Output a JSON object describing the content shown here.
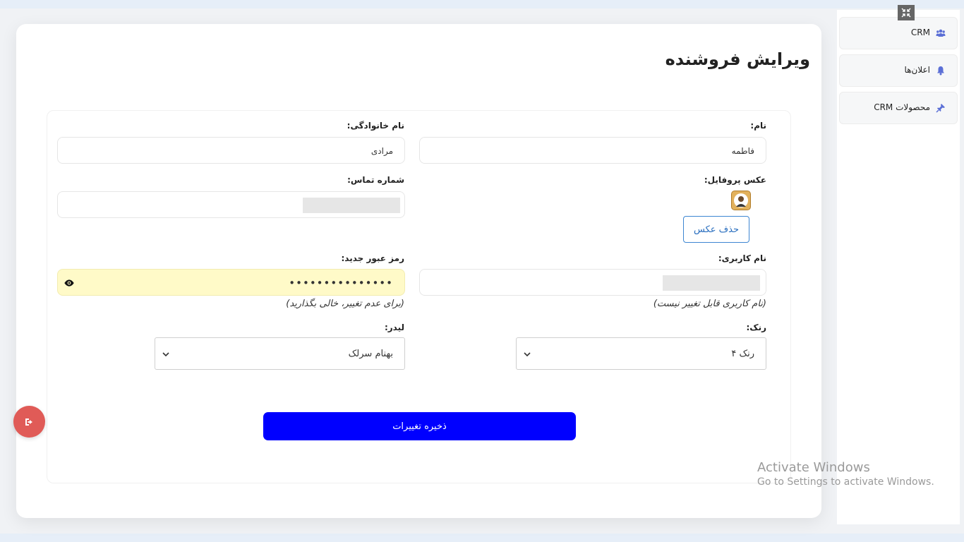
{
  "page": {
    "title": "ویرایش فروشنده"
  },
  "form": {
    "first_name": {
      "label": "نام:",
      "value": "فاطمه"
    },
    "last_name": {
      "label": "نام خانوادگی:",
      "value": "مرادی"
    },
    "profile_photo": {
      "label": "عکس پروفایل:",
      "delete_label": "حذف عکس"
    },
    "phone": {
      "label": "شماره تماس:"
    },
    "username": {
      "label": "نام کاربری:",
      "hint": "(نام کاربری قابل تغییر نیست)"
    },
    "password": {
      "label": "رمز عبور جدید:",
      "value": "•••••••••••••••",
      "hint": "(برای عدم تغییر، خالی بگذارید)"
    },
    "rank": {
      "label": "رنک:",
      "selected": "رنک ۴"
    },
    "leader": {
      "label": "لیدر:",
      "selected": "بهنام سرلک"
    },
    "save_label": "ذخیره تغییرات"
  },
  "sidebar": {
    "items": [
      {
        "label": "CRM",
        "icon": "users-icon"
      },
      {
        "label": "اعلان‌ها",
        "icon": "bell-icon"
      },
      {
        "label": "محصولات CRM",
        "icon": "pin-icon"
      }
    ]
  },
  "watermark": {
    "title": "Activate Windows",
    "subtitle": "Go to Settings to activate Windows."
  },
  "colors": {
    "primary_button": "#0000ff",
    "password_field_bg": "#fffac8",
    "logout_button": "#e05b57",
    "sidebar_icon": "#5b6fd6"
  }
}
